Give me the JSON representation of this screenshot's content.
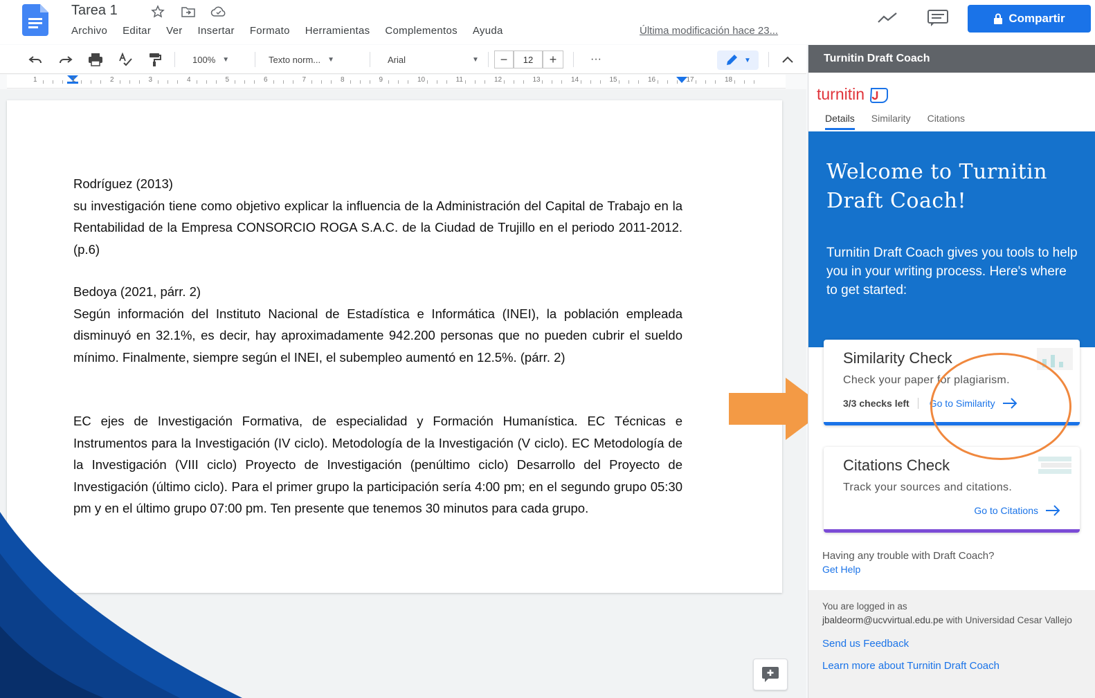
{
  "header": {
    "title": "Tarea 1",
    "menu": [
      "Archivo",
      "Editar",
      "Ver",
      "Insertar",
      "Formato",
      "Herramientas",
      "Complementos",
      "Ayuda"
    ],
    "last_edit": "Última modificación hace 23...",
    "share_label": "Compartir"
  },
  "toolbar": {
    "zoom": "100%",
    "style": "Texto norm...",
    "font": "Arial",
    "font_size": "12",
    "more": "···",
    "minus": "−",
    "plus": "+"
  },
  "ruler": {
    "numbers": [
      "1",
      "1",
      "2",
      "3",
      "4",
      "5",
      "6",
      "7",
      "8",
      "9",
      "10",
      "11",
      "12",
      "13",
      "14",
      "15",
      "16",
      "17",
      "18"
    ]
  },
  "document": {
    "cite1_head": "Rodríguez (2013)",
    "cite1_body": "su investigación tiene como objetivo explicar la influencia de la Administración del Capital de Trabajo en la Rentabilidad de la Empresa CONSORCIO ROGA S.A.C. de la Ciudad de Trujillo en el periodo 2011-2012. (p.6)",
    "cite2_head": "Bedoya (2021, párr. 2)",
    "cite2_body": "Según información del Instituto Nacional de Estadística e Informática (INEI), la población empleada disminuyó en 32.1%, es decir, hay aproximadamente 942.200 personas que no pueden cubrir el sueldo mínimo. Finalmente, siempre según el INEI, el subempleo aumentó en 12.5%. (párr. 2)",
    "para3": "EC ejes de Investigación Formativa, de especialidad y Formación Humanística. EC Técnicas e Instrumentos para la Investigación (IV ciclo). Metodología de la Investigación (V ciclo). EC Metodología de la Investigación (VIII ciclo) Proyecto de Investigación (penúltimo ciclo) Desarrollo del Proyecto de Investigación (último ciclo). Para el primer grupo la participación sería 4:00 pm; en el segundo grupo 05:30 pm y en el último grupo 07:00 pm. Ten presente que tenemos 30 minutos para cada grupo."
  },
  "sidebar": {
    "header": "Turnitin Draft Coach",
    "logo_text": "turnitin",
    "tabs": [
      "Details",
      "Similarity",
      "Citations"
    ],
    "welcome_title": "Welcome to Turnitin Draft Coach!",
    "welcome_body": "Turnitin Draft Coach gives you tools to help you in your writing process. Here's where to get started:",
    "similarity": {
      "title": "Similarity Check",
      "subtitle": "Check your paper for plagiarism.",
      "checks_left": "3/3 checks left",
      "link": "Go to Similarity"
    },
    "citations": {
      "title": "Citations Check",
      "subtitle": "Track your sources and citations.",
      "link": "Go to Citations"
    },
    "help_text": "Having any trouble with Draft Coach?",
    "help_link": "Get Help",
    "logged_in_label": "You are logged in as",
    "email": "jbaldeorm@ucvvirtual.edu.pe",
    "with_text": "with",
    "institution": "Universidad Cesar Vallejo",
    "feedback_link": "Send us Feedback",
    "learn_link": "Learn more about Turnitin Draft Coach"
  },
  "colors": {
    "accent": "#1a73e8",
    "turnitin_blue": "#1572cc",
    "annotation_orange": "#f0883e",
    "citations_purple": "#7b4bd6"
  }
}
